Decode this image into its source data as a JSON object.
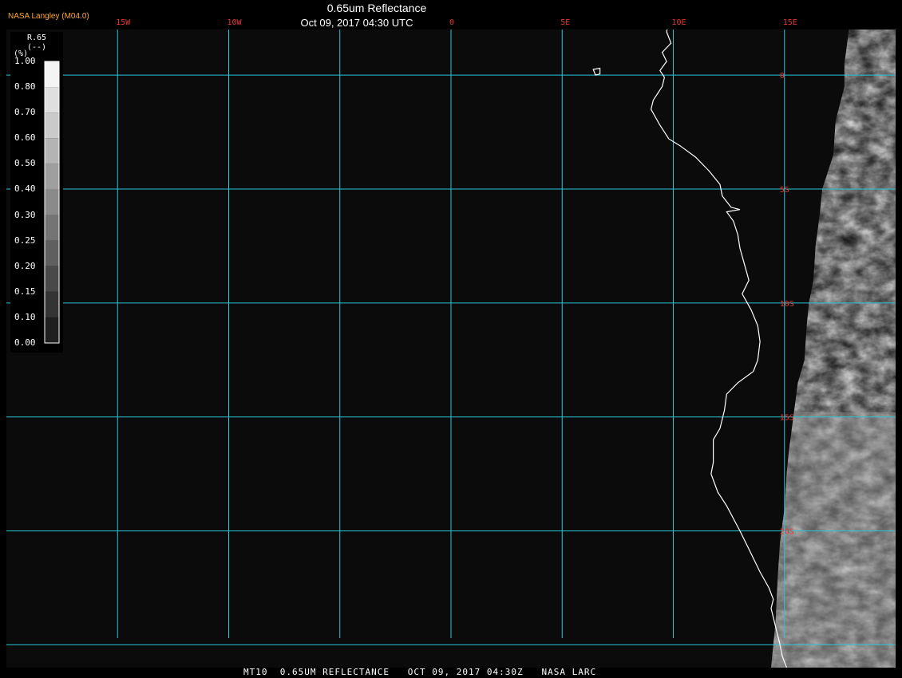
{
  "header": {
    "agency": "NASA Langley (M04.0)",
    "title": "0.65um Reflectance",
    "subtitle": "Oct 09, 2017 04:30 UTC"
  },
  "footer": {
    "text": "MT10  0.65UM REFLECTANCE   OCT 09, 2017 04:30Z   NASA LARC"
  },
  "colorbar": {
    "name": "R.65",
    "units": "(--)",
    "extra": "(%)",
    "ticks": [
      "1.00",
      "0.80",
      "0.70",
      "0.60",
      "0.50",
      "0.40",
      "0.30",
      "0.25",
      "0.20",
      "0.15",
      "0.10",
      "0.00"
    ]
  },
  "colors": {
    "grid": "#29c6d6",
    "grid_label": "#e53935",
    "coastline": "#ffffff",
    "background": "#0b0b0b",
    "agency_text": "#ffa726"
  },
  "map": {
    "projection": "latitude-longitude",
    "lon_range": [
      -20,
      20
    ],
    "lat_range": [
      2,
      -26
    ],
    "grid": {
      "meridians": [
        {
          "lon": -15,
          "label": "15W"
        },
        {
          "lon": -10,
          "label": "10W"
        },
        {
          "lon": -5,
          "label": ""
        },
        {
          "lon": 0,
          "label": "0"
        },
        {
          "lon": 5,
          "label": "5E"
        },
        {
          "lon": 10,
          "label": "10E"
        },
        {
          "lon": 15,
          "label": "15E"
        }
      ],
      "parallels": [
        {
          "lat": 0,
          "label": "0"
        },
        {
          "lat": -5,
          "label": "5S"
        },
        {
          "lat": -10,
          "label": "10S"
        },
        {
          "lat": -15,
          "label": "15S"
        },
        {
          "lat": -20,
          "label": "20S"
        },
        {
          "lat": -25,
          "label": ""
        }
      ]
    },
    "coastline": [
      [
        9.9,
        3.0
      ],
      [
        9.8,
        2.4
      ],
      [
        9.7,
        1.9
      ],
      [
        9.9,
        1.4
      ],
      [
        9.5,
        1.0
      ],
      [
        9.7,
        0.6
      ],
      [
        9.4,
        0.2
      ],
      [
        9.6,
        -0.1
      ],
      [
        9.5,
        -0.5
      ],
      [
        9.3,
        -0.8
      ],
      [
        9.1,
        -1.1
      ],
      [
        9.0,
        -1.5
      ],
      [
        9.4,
        -2.2
      ],
      [
        9.8,
        -2.8
      ],
      [
        10.3,
        -3.1
      ],
      [
        11.0,
        -3.6
      ],
      [
        11.6,
        -4.2
      ],
      [
        12.1,
        -4.8
      ],
      [
        12.2,
        -5.3
      ],
      [
        12.6,
        -5.8
      ],
      [
        13.0,
        -5.9
      ],
      [
        12.4,
        -6.0
      ],
      [
        12.7,
        -6.4
      ],
      [
        12.9,
        -7.0
      ],
      [
        13.0,
        -7.6
      ],
      [
        13.2,
        -8.3
      ],
      [
        13.4,
        -9.0
      ],
      [
        13.1,
        -9.6
      ],
      [
        13.5,
        -10.3
      ],
      [
        13.8,
        -11.0
      ],
      [
        13.9,
        -11.7
      ],
      [
        13.8,
        -12.5
      ],
      [
        13.6,
        -13.0
      ],
      [
        12.9,
        -13.5
      ],
      [
        12.4,
        -14.0
      ],
      [
        12.3,
        -14.7
      ],
      [
        12.1,
        -15.5
      ],
      [
        11.8,
        -16.0
      ],
      [
        11.8,
        -17.0
      ],
      [
        11.7,
        -17.5
      ],
      [
        12.0,
        -18.3
      ],
      [
        12.4,
        -18.9
      ],
      [
        13.0,
        -20.0
      ],
      [
        13.4,
        -20.8
      ],
      [
        13.9,
        -21.8
      ],
      [
        14.3,
        -22.5
      ],
      [
        14.5,
        -23.0
      ],
      [
        14.4,
        -23.4
      ],
      [
        14.6,
        -24.2
      ],
      [
        14.8,
        -25.0
      ],
      [
        14.9,
        -25.5
      ],
      [
        15.1,
        -26.0
      ]
    ],
    "islands": [
      [
        [
          6.4,
          0.25
        ],
        [
          6.7,
          0.3
        ],
        [
          6.7,
          0.05
        ],
        [
          6.5,
          0.0
        ],
        [
          6.4,
          0.25
        ]
      ]
    ],
    "imagery_boundary": [
      [
        17.9,
        2.0
      ],
      [
        17.7,
        0.5
      ],
      [
        17.7,
        -0.5
      ],
      [
        17.3,
        -2.0
      ],
      [
        17.2,
        -3.5
      ],
      [
        16.7,
        -5.0
      ],
      [
        16.6,
        -6.0
      ],
      [
        16.4,
        -7.5
      ],
      [
        16.3,
        -9.0
      ],
      [
        16.1,
        -10.0
      ],
      [
        16.0,
        -11.0
      ],
      [
        15.9,
        -12.5
      ],
      [
        15.6,
        -13.5
      ],
      [
        15.4,
        -15.0
      ],
      [
        15.2,
        -16.5
      ],
      [
        15.1,
        -17.5
      ],
      [
        15.0,
        -19.0
      ],
      [
        14.8,
        -20.5
      ],
      [
        14.7,
        -22.0
      ],
      [
        14.6,
        -24.0
      ],
      [
        14.4,
        -26.0
      ]
    ],
    "imagery_note": "cloud reflectance field visible on right edge of domain"
  }
}
